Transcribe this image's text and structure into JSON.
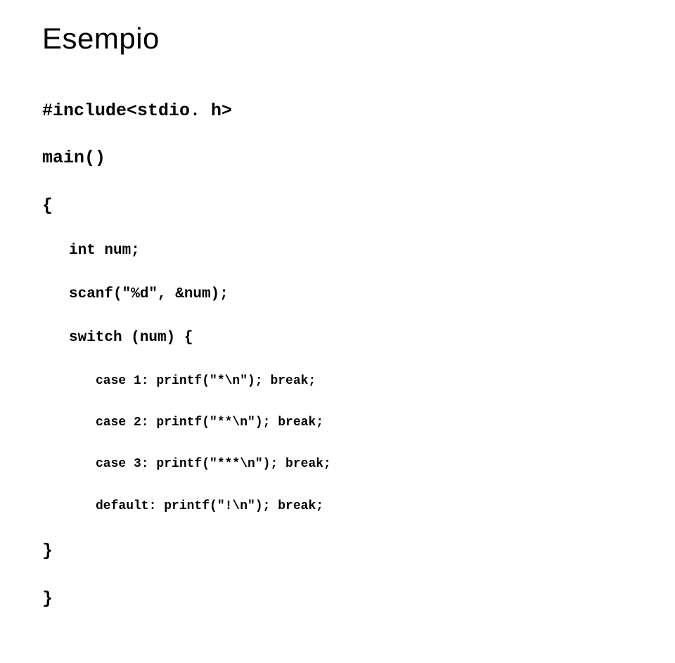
{
  "title": "Esempio",
  "code": {
    "l1": "#include<stdio. h>",
    "l2": "main()",
    "l3": "{",
    "l4": "int num;",
    "l5": "scanf(\"%d\", &num);",
    "l6": "switch (num) {",
    "l7": "case 1: printf(\"*\\n\"); break;",
    "l8": "case 2: printf(\"**\\n\"); break;",
    "l9": "case 3: printf(\"***\\n\"); break;",
    "l10": "default: printf(\"!\\n\"); break;",
    "l11": "}",
    "l12": "}"
  }
}
